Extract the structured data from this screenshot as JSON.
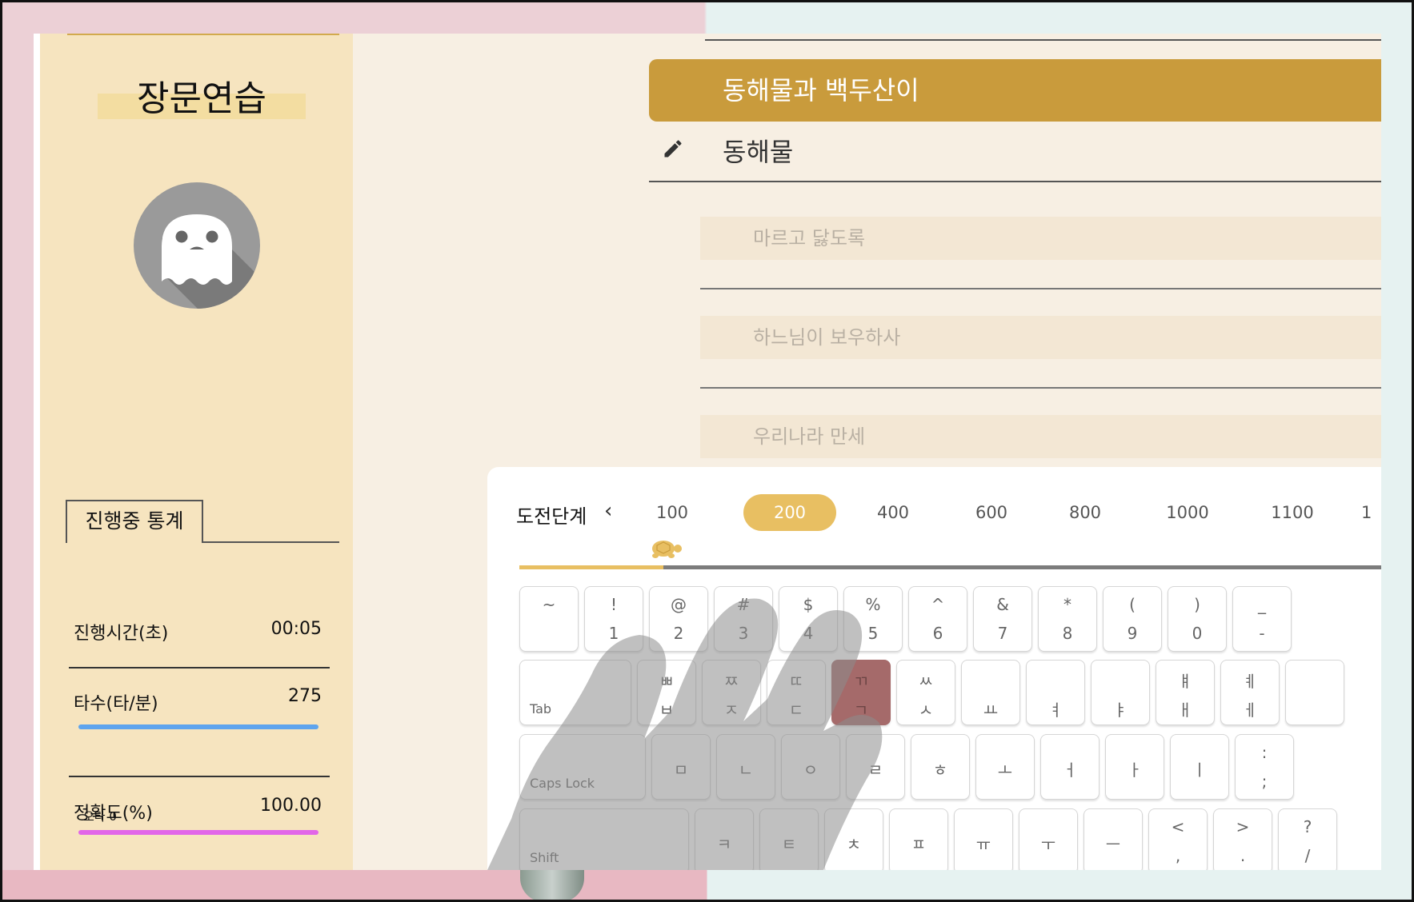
{
  "sidebar": {
    "title": "장문연습",
    "stats_tab": "진행중 통계",
    "stats": {
      "time_label": "진행시간(초)",
      "time_value": "00:05",
      "speed_label": "타수(타/분)",
      "speed_value": "275",
      "accuracy_label": "정확도(%)",
      "accuracy_value": "100.00",
      "typo_label": "오타 0"
    }
  },
  "colors": {
    "accent": "#c99b3c",
    "level_active": "#e8bf62",
    "speed_bar": "#5ea4ee",
    "accuracy_bar": "#e266e8",
    "sidebar_bg": "#f6e4bf",
    "highlight_key": "#a56a6a"
  },
  "practice": {
    "current_title": "동해물과 백두산이",
    "input_text": "동해물",
    "next_lines": [
      "마르고 닳도록",
      "하느님이 보우하사",
      "우리나라 만세"
    ]
  },
  "levels": {
    "label": "도전단계",
    "items": [
      "100",
      "200",
      "400",
      "600",
      "800",
      "1000",
      "1100",
      "1"
    ],
    "active": "200"
  },
  "keyboard": {
    "row1": [
      {
        "t": "~",
        "b": ""
      },
      {
        "t": "!",
        "b": "1"
      },
      {
        "t": "@",
        "b": "2"
      },
      {
        "t": "#",
        "b": "3"
      },
      {
        "t": "$",
        "b": "4"
      },
      {
        "t": "%",
        "b": "5"
      },
      {
        "t": "^",
        "b": "6"
      },
      {
        "t": "&",
        "b": "7"
      },
      {
        "t": "*",
        "b": "8"
      },
      {
        "t": "(",
        "b": "9"
      },
      {
        "t": ")",
        "b": "0"
      },
      {
        "t": "_",
        "b": "-"
      }
    ],
    "tab": "Tab",
    "row2": [
      {
        "t": "ㅃ",
        "b": "ㅂ"
      },
      {
        "t": "ㅉ",
        "b": "ㅈ"
      },
      {
        "t": "ㄸ",
        "b": "ㄷ"
      },
      {
        "t": "ㄲ",
        "b": "ㄱ"
      },
      {
        "t": "ㅆ",
        "b": "ㅅ"
      },
      {
        "t": "",
        "b": "ㅛ"
      },
      {
        "t": "",
        "b": "ㅕ"
      },
      {
        "t": "",
        "b": "ㅑ"
      },
      {
        "t": "ㅒ",
        "b": "ㅐ"
      },
      {
        "t": "ㅖ",
        "b": "ㅔ"
      }
    ],
    "caps": "Caps Lock",
    "row3": [
      "ㅁ",
      "ㄴ",
      "ㅇ",
      "ㄹ",
      "ㅎ",
      "ㅗ",
      "ㅓ",
      "ㅏ",
      "ㅣ"
    ],
    "row3_last": {
      "t": ":",
      "b": ";"
    },
    "shift": "Shift",
    "row4": [
      "ㅋ",
      "ㅌ",
      "ㅊ",
      "ㅍ",
      "ㅠ",
      "ㅜ",
      "ㅡ"
    ],
    "row4_sym": [
      {
        "t": "<",
        "b": ","
      },
      {
        "t": ">",
        "b": "."
      },
      {
        "t": "?",
        "b": "/"
      }
    ]
  }
}
